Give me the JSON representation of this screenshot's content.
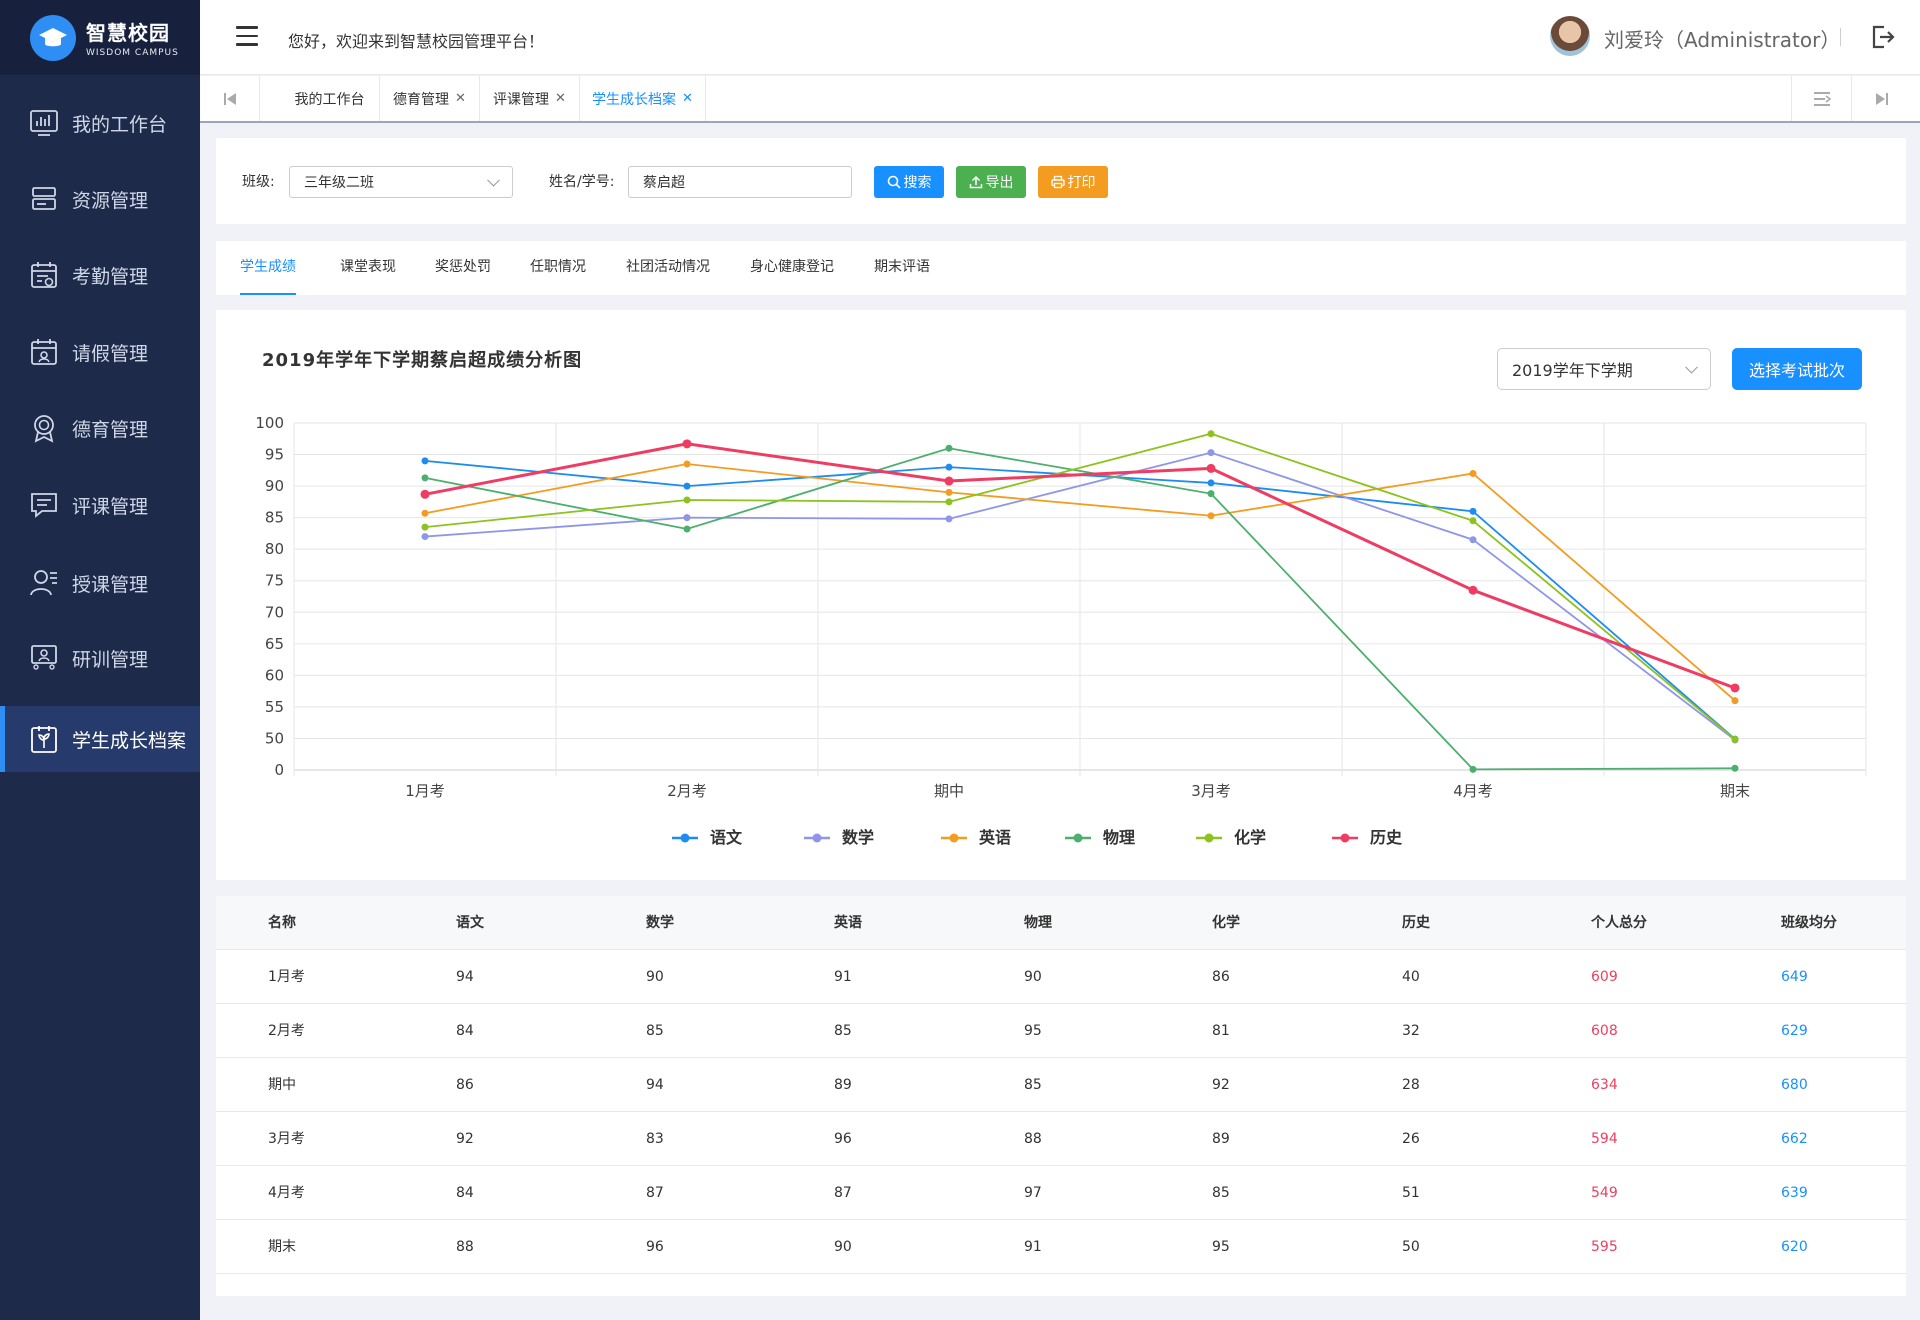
{
  "app": {
    "logo_cn": "智慧校园",
    "logo_en": "WISDOM CAMPUS",
    "welcome": "您好，欢迎来到智慧校园管理平台！",
    "user": "刘爱玲（Administrator）"
  },
  "sidebar": {
    "items": [
      {
        "label": "我的工作台",
        "icon": "dashboard-icon"
      },
      {
        "label": "资源管理",
        "icon": "resource-icon"
      },
      {
        "label": "考勤管理",
        "icon": "attendance-icon"
      },
      {
        "label": "请假管理",
        "icon": "leave-icon"
      },
      {
        "label": "德育管理",
        "icon": "badge-icon"
      },
      {
        "label": "评课管理",
        "icon": "comment-icon"
      },
      {
        "label": "授课管理",
        "icon": "teacher-icon"
      },
      {
        "label": "研训管理",
        "icon": "training-icon"
      },
      {
        "label": "学生成长档案",
        "icon": "growth-icon",
        "active": true
      }
    ]
  },
  "tabs": [
    {
      "label": "我的工作台",
      "closable": false
    },
    {
      "label": "德育管理",
      "closable": true
    },
    {
      "label": "评课管理",
      "closable": true
    },
    {
      "label": "学生成长档案",
      "closable": true,
      "active": true
    }
  ],
  "filters": {
    "class_label": "班级:",
    "class_value": "三年级二班",
    "name_label": "姓名/学号:",
    "name_value": "蔡启超",
    "search_btn": "搜索",
    "export_btn": "导出",
    "print_btn": "打印"
  },
  "subtabs": [
    "学生成绩",
    "课堂表现",
    "奖惩处罚",
    "任职情况",
    "社团活动情况",
    "身心健康登记",
    "期末评语"
  ],
  "chart_header": {
    "title": "2019年学年下学期蔡启超成绩分析图",
    "term": "2019学年下学期",
    "batch_btn": "选择考试批次"
  },
  "chart_data": {
    "type": "line",
    "categories": [
      "1月考",
      "2月考",
      "期中",
      "3月考",
      "4月考",
      "期末"
    ],
    "y_ticks": [
      0,
      50,
      55,
      60,
      65,
      70,
      75,
      80,
      85,
      90,
      95,
      100
    ],
    "ylim": [
      0,
      100
    ],
    "axis_note": "y axis: 0 at bottom, then evenly spaced 50 to 100",
    "grid": true,
    "legend_position": "bottom-center",
    "series": [
      {
        "name": "语文",
        "color": "#1c8cf0",
        "values": [
          94,
          90,
          93,
          90.5,
          86,
          49
        ]
      },
      {
        "name": "数学",
        "color": "#8f96e8",
        "values": [
          82,
          85,
          84.8,
          95.3,
          81.5,
          47.5
        ]
      },
      {
        "name": "英语",
        "color": "#f39c1f",
        "values": [
          85.7,
          93.5,
          89,
          85.3,
          92,
          56
        ]
      },
      {
        "name": "物理",
        "color": "#4caf6e",
        "values": [
          91.3,
          83.2,
          96,
          88.8,
          1,
          2.8
        ]
      },
      {
        "name": "化学",
        "color": "#8dc21f",
        "values": [
          83.5,
          87.8,
          87.5,
          98.3,
          84.5,
          48.5
        ]
      },
      {
        "name": "历史",
        "color": "#ee3c63",
        "values": [
          88.7,
          96.7,
          90.8,
          92.8,
          73.5,
          58
        ]
      }
    ]
  },
  "table": {
    "headers": [
      "名称",
      "语文",
      "数学",
      "英语",
      "物理",
      "化学",
      "历史",
      "个人总分",
      "班级均分"
    ],
    "rows": [
      [
        "1月考",
        "94",
        "90",
        "91",
        "90",
        "86",
        "40",
        "609",
        "649"
      ],
      [
        "2月考",
        "84",
        "85",
        "85",
        "95",
        "81",
        "32",
        "608",
        "629"
      ],
      [
        "期中",
        "86",
        "94",
        "89",
        "85",
        "92",
        "28",
        "634",
        "680"
      ],
      [
        "3月考",
        "92",
        "83",
        "96",
        "88",
        "89",
        "26",
        "594",
        "662"
      ],
      [
        "4月考",
        "84",
        "87",
        "87",
        "97",
        "85",
        "51",
        "549",
        "639"
      ],
      [
        "期末",
        "88",
        "96",
        "90",
        "91",
        "95",
        "50",
        "595",
        "620"
      ]
    ]
  },
  "colors": {
    "sidebar_bg": "#1e2a4a",
    "accent": "#1890ff",
    "export_green": "#4caf50",
    "print_orange": "#f39c1f",
    "total_red": "#ed3f5e"
  }
}
